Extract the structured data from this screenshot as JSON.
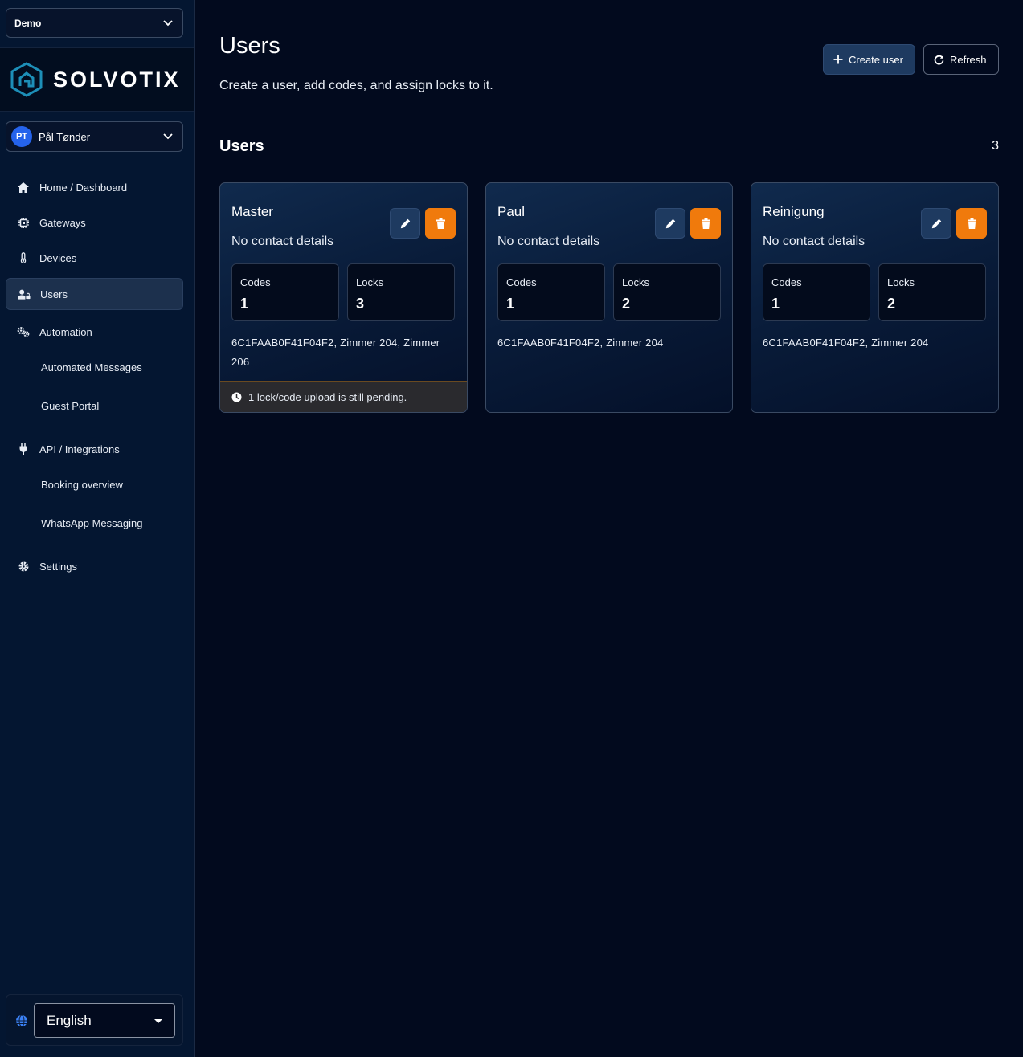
{
  "sidebar": {
    "org_select": "Demo",
    "logo_text": "SOLVOTIX",
    "user": {
      "initials": "PT",
      "name": "Pål Tønder"
    },
    "nav": [
      {
        "label": "Home / Dashboard",
        "icon": "home-icon"
      },
      {
        "label": "Gateways",
        "icon": "chip-icon"
      },
      {
        "label": "Devices",
        "icon": "thermometer-icon"
      },
      {
        "label": "Users",
        "icon": "user-lock-icon",
        "active": true
      },
      {
        "label": "Automation",
        "icon": "gears-icon"
      },
      {
        "label": "Automated Messages"
      },
      {
        "label": "Guest Portal"
      },
      {
        "label": "API / Integrations",
        "icon": "plug-icon"
      },
      {
        "label": "Booking overview"
      },
      {
        "label": "WhatsApp Messaging"
      },
      {
        "label": "Settings",
        "icon": "gear-icon"
      }
    ],
    "language": "English"
  },
  "header": {
    "title": "Users",
    "subtitle": "Create a user, add codes, and assign locks to it.",
    "create_label": "Create user",
    "refresh_label": "Refresh"
  },
  "section": {
    "title": "Users",
    "count": "3"
  },
  "cards": [
    {
      "name": "Master",
      "contact": "No contact details",
      "codes_label": "Codes",
      "codes": "1",
      "locks_label": "Locks",
      "locks": "3",
      "lock_list": "6C1FAAB0F41F04F2, Zimmer 204, Zimmer 206",
      "pending": "1 lock/code upload is still pending."
    },
    {
      "name": "Paul",
      "contact": "No contact details",
      "codes_label": "Codes",
      "codes": "1",
      "locks_label": "Locks",
      "locks": "2",
      "lock_list": "6C1FAAB0F41F04F2, Zimmer 204"
    },
    {
      "name": "Reinigung",
      "contact": "No contact details",
      "codes_label": "Codes",
      "codes": "1",
      "locks_label": "Locks",
      "locks": "2",
      "lock_list": "6C1FAAB0F41F04F2, Zimmer 204"
    }
  ],
  "colors": {
    "accent_orange": "#f07a0c",
    "accent_blue": "#1e3a60",
    "background": "#020a1e",
    "sidebar": "#041631"
  }
}
